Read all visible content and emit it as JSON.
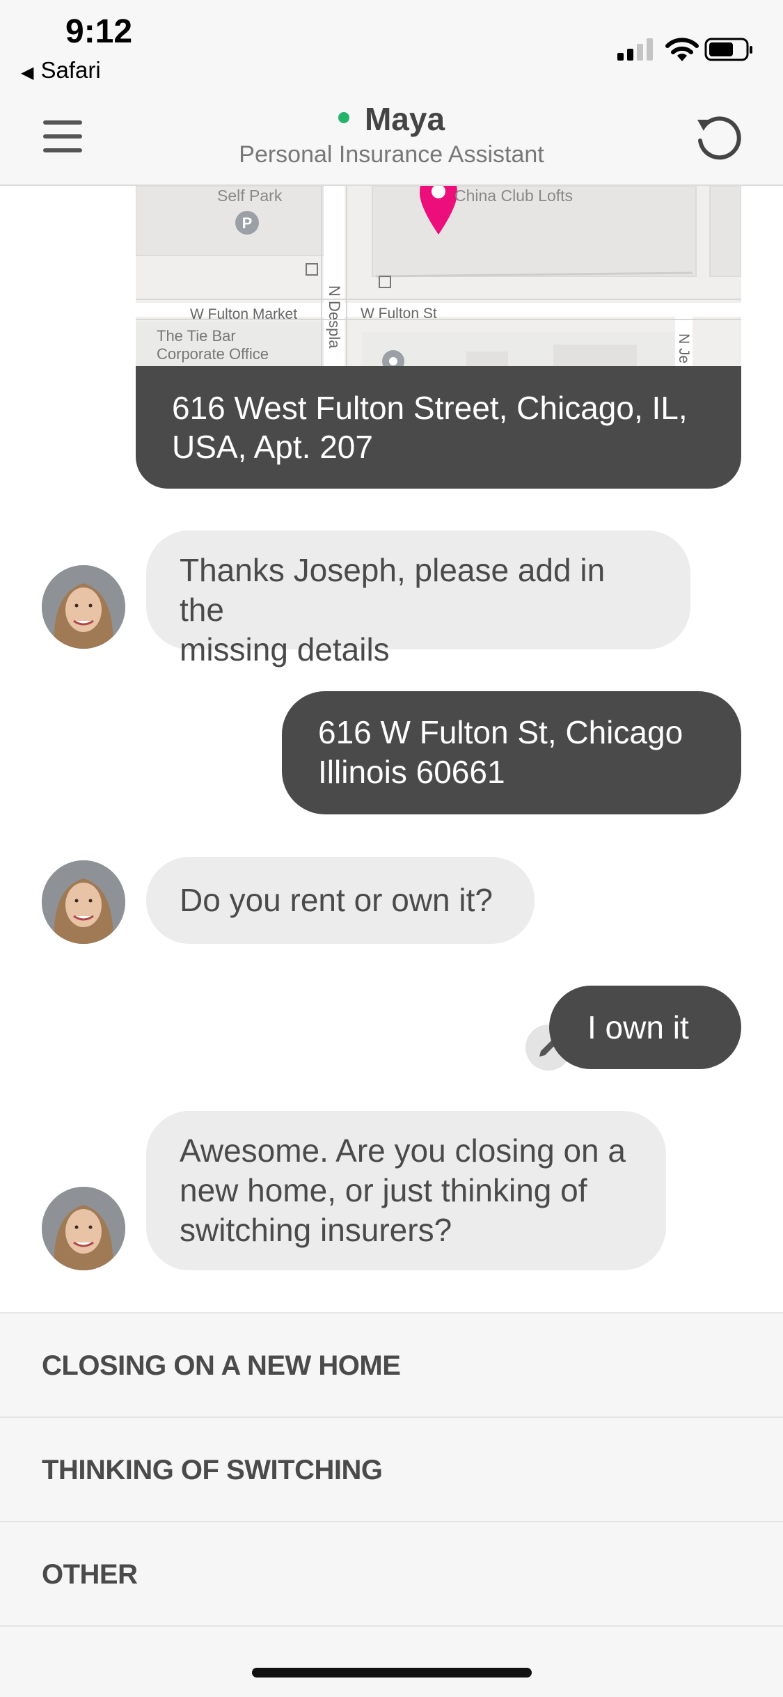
{
  "status_bar": {
    "time": "9:12",
    "back_app": "Safari",
    "signal_icon": "cellular-signal-icon",
    "wifi_icon": "wifi-icon",
    "battery_icon": "battery-icon"
  },
  "header": {
    "title": "Maya",
    "subtitle": "Personal Insurance Assistant",
    "online_color": "#25b36c",
    "menu_icon": "hamburger-menu-icon",
    "refresh_icon": "refresh-icon"
  },
  "map": {
    "labels": {
      "self_park": "Self Park",
      "china_club": "China Club Lofts",
      "w_fulton_market": "W Fulton Market",
      "w_fulton_st": "W Fulton St",
      "tie_bar_1": "The Tie Bar",
      "tie_bar_2": "Corporate Office",
      "n_despla": "N Despla",
      "n_je": "N Je"
    },
    "pin_color": "#ec0e7b"
  },
  "messages": [
    {
      "sender": "user",
      "text": "616 West Fulton Street, Chicago, IL, USA, Apt. 207"
    },
    {
      "sender": "assistant",
      "lines": [
        "Thanks Joseph, please add in the",
        "missing details"
      ]
    },
    {
      "sender": "user",
      "lines": [
        "616 W Fulton St, Chicago",
        "Illinois 60661"
      ]
    },
    {
      "sender": "assistant",
      "text": "Do you rent or own it?"
    },
    {
      "sender": "user",
      "text": "I own it"
    },
    {
      "sender": "assistant",
      "lines": [
        "Awesome. Are you closing on a",
        "new home, or just thinking of",
        "switching insurers?"
      ]
    }
  ],
  "edit_icon": "pencil-icon",
  "quick_replies": [
    "CLOSING ON A NEW HOME",
    "THINKING OF SWITCHING",
    "OTHER"
  ],
  "colors": {
    "user_bubble": "#4a4a4a",
    "assistant_bubble": "#ececec"
  }
}
